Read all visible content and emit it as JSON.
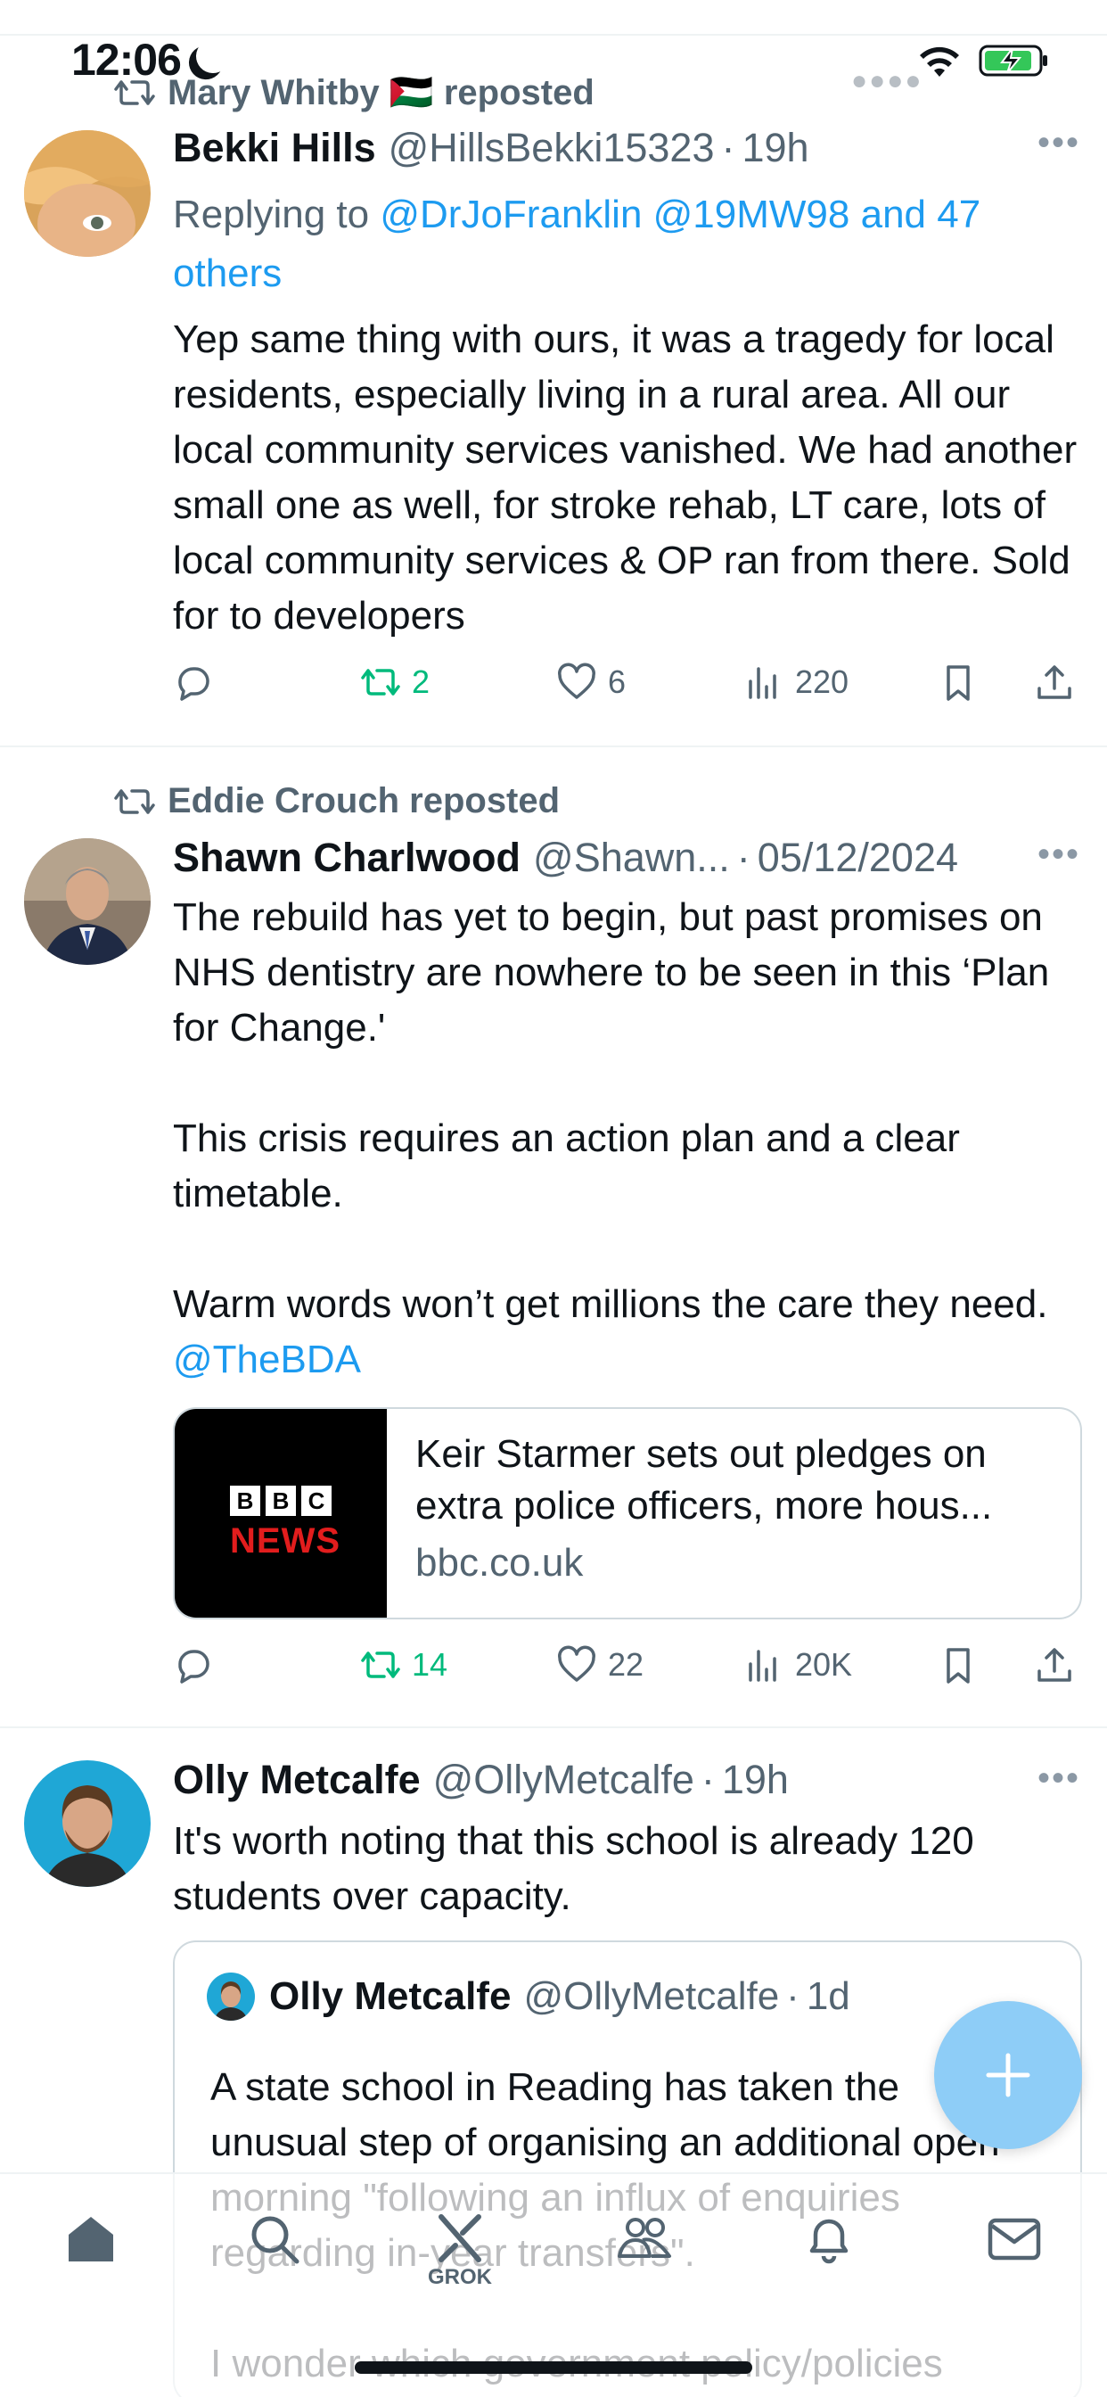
{
  "status_bar": {
    "time": "12:06"
  },
  "tweets": [
    {
      "reposted_by": "Mary Whitby 🇵🇸 reposted",
      "name": "Bekki Hills",
      "handle": "@HillsBekki15323",
      "time": "19h",
      "replying_prefix": "Replying to ",
      "replying_to": "@DrJoFranklin @19MW98 and 47 others",
      "text": "Yep same thing with ours, it was a tragedy for local residents, especially living in a rural area. All our local community services vanished. We had another small one as well, for stroke rehab, LT care, lots of local community services & OP ran from there. Sold for to developers",
      "replies": "",
      "reposts": "2",
      "likes": "6",
      "views": "220"
    },
    {
      "reposted_by": "Eddie Crouch reposted",
      "name": "Shawn Charlwood",
      "handle": "@Shawn...",
      "time": "05/12/2024",
      "text": "The rebuild has yet to begin, but past promises on NHS dentistry are nowhere to be seen in this ‘Plan for Change.'\n\nThis crisis requires an action plan and a clear timetable.\n\nWarm words won’t get millions the care they need. ",
      "mention": "@TheBDA",
      "card": {
        "logo_letters": [
          "B",
          "B",
          "C"
        ],
        "logo_text": "NEWS",
        "title": "Keir Starmer sets out pledges on extra police officers, more hous...",
        "domain": "bbc.co.uk"
      },
      "reposts": "14",
      "likes": "22",
      "views": "20K"
    },
    {
      "name": "Olly Metcalfe",
      "handle": "@OllyMetcalfe",
      "time": "19h",
      "text": "It's worth noting that this school is already 120 students over capacity.",
      "quote": {
        "name": "Olly Metcalfe",
        "handle": "@OllyMetcalfe",
        "time": "1d",
        "text": "A state school in Reading has taken the unusual step of organising an additional open morning \"following an influx of enquiries regarding in-year transfers\".\n\nI wonder which government policy/policies might be driving up uptake in..."
      }
    }
  ],
  "nav": {
    "grok_label": "GROK"
  },
  "colors": {
    "accent": "#1d9bf0",
    "repost_green": "#00ba7c",
    "secondary_text": "#536471",
    "fab": "#8ecdf7"
  },
  "icons": [
    "reply-icon",
    "repost-icon",
    "like-icon",
    "views-icon",
    "bookmark-icon",
    "share-icon",
    "home-icon",
    "search-icon",
    "grok-icon",
    "communities-icon",
    "notifications-icon",
    "messages-icon",
    "compose-plus-icon"
  ]
}
